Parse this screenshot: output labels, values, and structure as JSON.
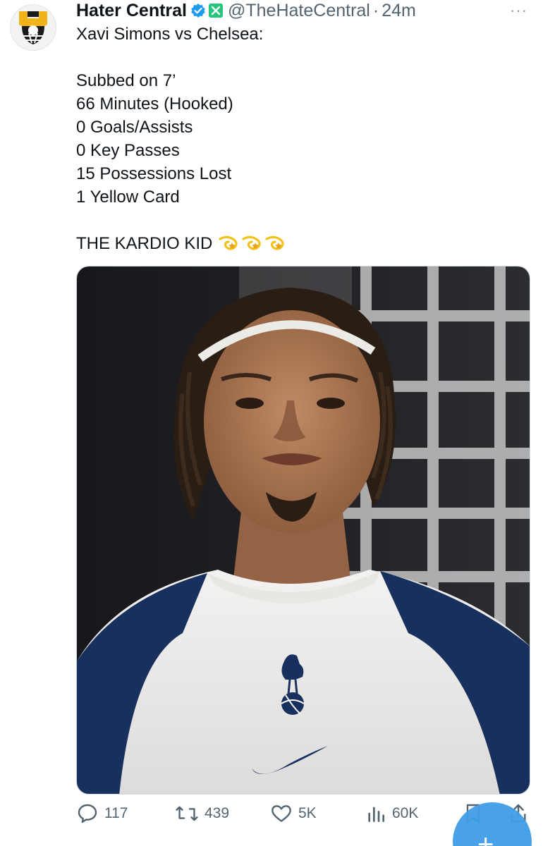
{
  "author": {
    "name": "Hater Central",
    "handle": "@TheHateCentral",
    "separator": "·",
    "time": "24m"
  },
  "menu": {
    "more_label": "···"
  },
  "tweet": {
    "lines": [
      "Xavi Simons vs Chelsea:",
      "",
      "Subbed on 7’",
      "66 Minutes (Hooked)",
      "0 Goals/Assists",
      "0 Key Passes",
      "15 Possessions Lost",
      "1 Yellow Card",
      "",
      "THE KARDIO KID"
    ],
    "emoji": [
      "dizzy-emoji",
      "dizzy-emoji",
      "dizzy-emoji"
    ]
  },
  "stats": {
    "replies": "117",
    "retweets": "439",
    "likes": "5K",
    "views": "60K"
  },
  "icons": {
    "reply": "reply-icon",
    "retweet": "retweet-icon",
    "like": "heart-icon",
    "views": "views-icon",
    "bookmark": "bookmark-icon",
    "share": "share-icon",
    "compose": "plus-icon"
  },
  "colors": {
    "text": "#0f1419",
    "muted": "#536471",
    "verified": "#1d9bf0",
    "x_badge": "#27c47d",
    "fab": "#3f9de6"
  },
  "fab": {
    "label": "+"
  }
}
